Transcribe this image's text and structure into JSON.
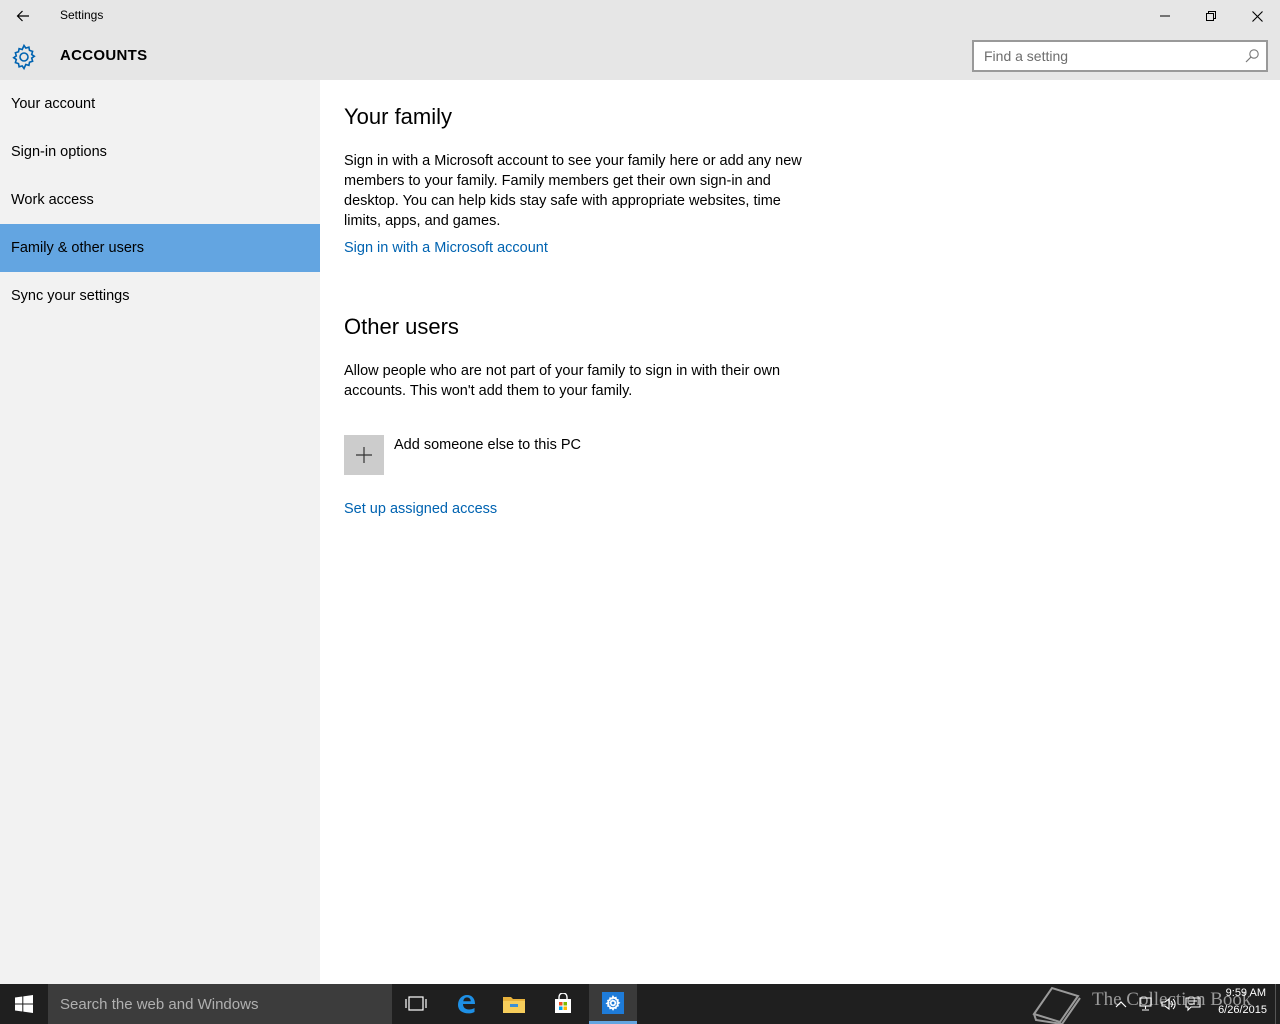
{
  "window": {
    "app_title": "Settings"
  },
  "header": {
    "title": "ACCOUNTS",
    "search_placeholder": "Find a setting"
  },
  "sidebar": {
    "items": [
      {
        "label": "Your account"
      },
      {
        "label": "Sign-in options"
      },
      {
        "label": "Work access"
      },
      {
        "label": "Family & other users",
        "selected": true
      },
      {
        "label": "Sync your settings"
      }
    ]
  },
  "main": {
    "family": {
      "heading": "Your family",
      "description": "Sign in with a Microsoft account to see your family here or add any new members to your family. Family members get their own sign-in and desktop. You can help kids stay safe with appropriate websites, time limits, apps, and games.",
      "link": "Sign in with a Microsoft account"
    },
    "other_users": {
      "heading": "Other users",
      "description": "Allow people who are not part of your family to sign in with their own accounts. This won't add them to your family.",
      "add_label": "Add someone else to this PC",
      "assigned_access_link": "Set up assigned access"
    }
  },
  "taskbar": {
    "search_placeholder": "Search the web and Windows",
    "watermark": "The Collection Book",
    "time": "9:59 AM",
    "date": "6/26/2015"
  },
  "colors": {
    "accent": "#63a5e1",
    "link": "#0063b1",
    "sidebar_bg": "#f2f2f2",
    "titlebar_bg": "#e6e6e6",
    "taskbar_bg": "#1f1f1f"
  },
  "icons": {
    "back": "back-arrow-icon",
    "minimize": "minimize-icon",
    "maximize": "restore-icon",
    "close": "close-icon",
    "header": "gear-icon",
    "search": "search-icon",
    "add": "plus-icon",
    "start": "windows-logo-icon",
    "task_view": "task-view-icon",
    "edge": "edge-icon",
    "explorer": "file-explorer-icon",
    "store": "store-icon",
    "settings": "settings-gear-icon"
  }
}
